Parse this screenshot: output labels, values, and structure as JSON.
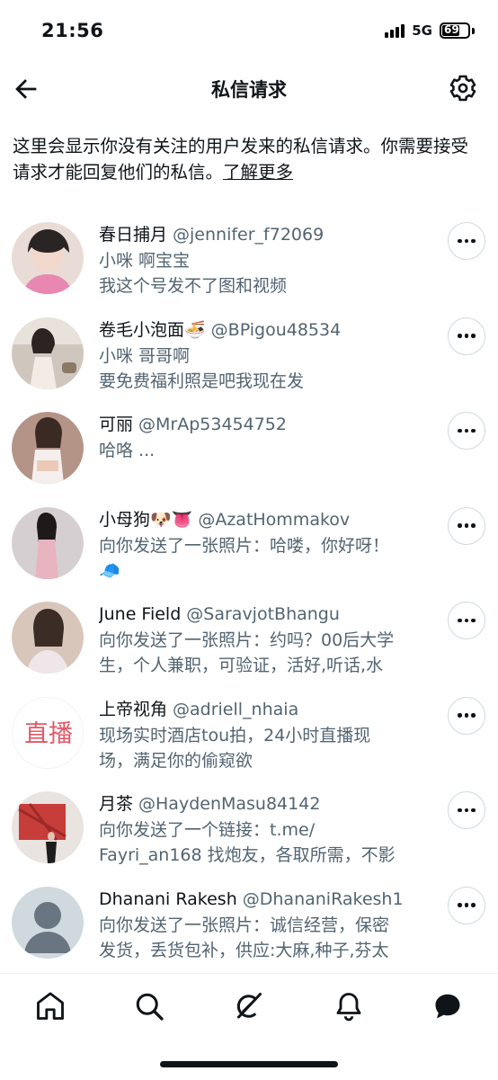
{
  "status": {
    "time": "21:56",
    "network": "5G",
    "battery": "69",
    "battery_level": 0.69
  },
  "header": {
    "title": "私信请求"
  },
  "info": {
    "text": "这里会显示你没有关注的用户发来的私信请求。你需要接受请求才能回复他们的私信。",
    "link": "了解更多"
  },
  "requests": [
    {
      "name": "春日捕月",
      "handle": "@jennifer_f72069",
      "lines": [
        "小咪 啊宝宝",
        "我这个号发不了图和视频"
      ],
      "avatar_color": "#e9b9c6",
      "avatar_text": ""
    },
    {
      "name": "卷毛小泡面🍜",
      "handle": "@BPigou48534",
      "lines": [
        "小咪 哥哥啊",
        "要免费福利照是吧我现在发"
      ],
      "avatar_color": "#d9cfc4",
      "avatar_text": ""
    },
    {
      "name": "可丽",
      "handle": "@MrAp53454752",
      "lines": [
        "哈咯 ..."
      ],
      "avatar_color": "#c9a99c",
      "avatar_text": ""
    },
    {
      "name": "小母狗🐶👅",
      "handle": "@AzatHommakov",
      "lines": [
        "向你发送了一张照片：哈喽，你好呀！",
        "🧢"
      ],
      "avatar_color": "#cfc3c6",
      "avatar_text": ""
    },
    {
      "name": "June Field",
      "handle": "@SaravjotBhangu",
      "lines": [
        "向你发送了一张照片：约吗？00后大学",
        "生，个人兼职，可验证，活好,听话,水"
      ],
      "avatar_color": "#d8bfb2",
      "avatar_text": ""
    },
    {
      "name": "上帝视角",
      "handle": "@adriell_nhaia",
      "lines": [
        "现场实时酒店tou拍，24小时直播现",
        "场，满足你的偷窥欲"
      ],
      "avatar_color": "#ffffff",
      "avatar_text": "直播"
    },
    {
      "name": "月茶",
      "handle": "@HaydenMasu84142",
      "lines": [
        "向你发送了一个链接：t.me/",
        "Fayri_an168 找炮友，各取所需，不影"
      ],
      "avatar_color": "#b8433f",
      "avatar_text": ""
    },
    {
      "name": "Dhanani Rakesh",
      "handle": "@DhananiRakesh1",
      "lines": [
        "向你发送了一张照片：诚信经营，保密",
        "发货，丢货包补，供应:大麻,种子,芬太"
      ],
      "avatar_color": "#cfd9de",
      "avatar_text": ""
    }
  ],
  "tabs": [
    "home-icon",
    "search-icon",
    "grok-icon",
    "notifications-icon",
    "messages-icon"
  ]
}
